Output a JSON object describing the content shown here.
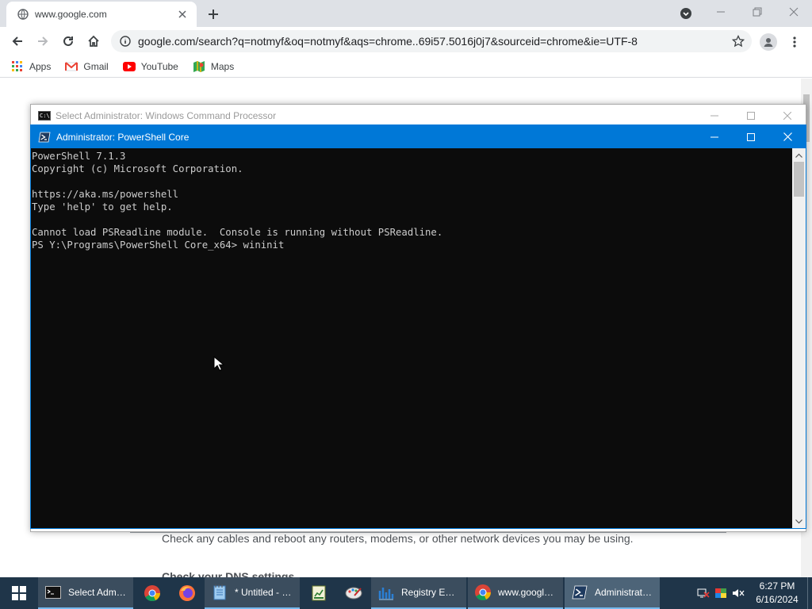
{
  "browser": {
    "tab_title": "www.google.com",
    "url": "google.com/search?q=notmyf&oq=notmyf&aqs=chrome..69i57.5016j0j7&sourceid=chrome&ie=UTF-8",
    "bookmarks": [
      {
        "label": "Apps",
        "icon": "apps-grid-icon"
      },
      {
        "label": "Gmail",
        "icon": "gmail-icon"
      },
      {
        "label": "YouTube",
        "icon": "youtube-icon"
      },
      {
        "label": "Maps",
        "icon": "maps-icon"
      }
    ]
  },
  "page_behind": {
    "text_line": "Check any cables and reboot any routers, modems, or other network devices you may be using.",
    "text_heading": "Check your DNS settings"
  },
  "cmd_window": {
    "title": "Select Administrator: Windows Command Processor"
  },
  "ps_window": {
    "title": "Administrator: PowerShell Core",
    "console_lines": [
      "PowerShell 7.1.3",
      "Copyright (c) Microsoft Corporation.",
      "",
      "https://aka.ms/powershell",
      "Type 'help' to get help.",
      "",
      "Cannot load PSReadline module.  Console is running without PSReadline.",
      "PS Y:\\Programs\\PowerShell Core_x64> wininit"
    ]
  },
  "taskbar": {
    "items": [
      {
        "label": "Select Admin...",
        "icon": "cmd-icon"
      },
      {
        "label": "",
        "icon": "chrome-icon"
      },
      {
        "label": "",
        "icon": "firefox-icon"
      },
      {
        "label": "* Untitled - N...",
        "icon": "notepad-icon"
      },
      {
        "label": "",
        "icon": "spreadsheet-icon"
      },
      {
        "label": "",
        "icon": "paint-icon"
      },
      {
        "label": "Registry Editor",
        "icon": "regedit-icon"
      },
      {
        "label": "www.google....",
        "icon": "chrome-icon"
      },
      {
        "label": "Administrato...",
        "icon": "powershell-icon"
      }
    ],
    "clock_time": "6:27 PM",
    "clock_date": "6/16/2024"
  },
  "colors": {
    "ps_titlebar": "#0078d7",
    "console_bg": "#0c0c0c",
    "console_text": "#cccccc",
    "taskbar_bg": "#1f3549"
  }
}
